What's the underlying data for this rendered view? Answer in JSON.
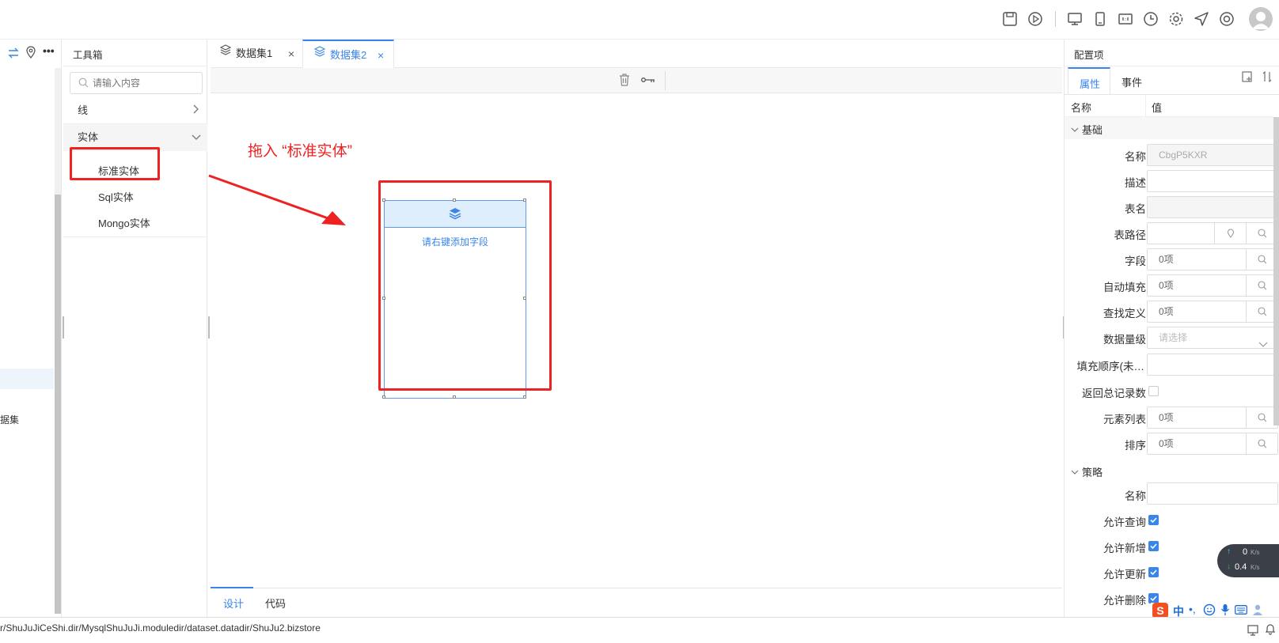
{
  "topbar": {
    "icons": [
      "save-icon",
      "play-icon",
      "desktop-icon",
      "mobile-icon",
      "ratio-icon",
      "history-icon",
      "gear-icon",
      "send-icon",
      "help-icon",
      "avatar"
    ]
  },
  "left_panel": {
    "partial_label": "据集"
  },
  "toolbox": {
    "title": "工具箱",
    "search_placeholder": "请输入内容",
    "groups": [
      {
        "label": "线"
      },
      {
        "label": "实体"
      }
    ],
    "entity_items": [
      "标准实体",
      "Sql实体",
      "Mongo实体"
    ]
  },
  "canvas": {
    "tabs": [
      {
        "label": "数据集1",
        "active": false
      },
      {
        "label": "数据集2",
        "active": true
      }
    ],
    "annotation": "拖入 “标准实体”",
    "entity_hint": "请右键添加字段",
    "bottom_tabs": [
      {
        "label": "设计",
        "active": true
      },
      {
        "label": "代码",
        "active": false
      }
    ]
  },
  "config_panel": {
    "title": "配置项",
    "tabs": [
      {
        "label": "属性",
        "active": true
      },
      {
        "label": "事件",
        "active": false
      }
    ],
    "header_name": "名称",
    "header_value": "值",
    "section_basic": "基础",
    "section_policy": "策略",
    "fields": [
      {
        "label": "名称",
        "value": "CbgP5KXR"
      },
      {
        "label": "描述",
        "value": ""
      },
      {
        "label": "表名",
        "value": ""
      },
      {
        "label": "表路径",
        "value": ""
      },
      {
        "label": "字段",
        "value": "0项"
      },
      {
        "label": "自动填充",
        "value": "0项"
      },
      {
        "label": "查找定义",
        "value": "0项"
      },
      {
        "label": "数据量级",
        "value": "请选择"
      },
      {
        "label": "填充顺序(未…",
        "value": ""
      },
      {
        "label": "返回总记录数",
        "value": ""
      },
      {
        "label": "元素列表",
        "value": "0项"
      },
      {
        "label": "排序",
        "value": "0项"
      }
    ],
    "policy_fields": [
      {
        "label": "名称",
        "value": ""
      },
      {
        "label": "允许查询"
      },
      {
        "label": "允许新增"
      },
      {
        "label": "允许更新"
      },
      {
        "label": "允许删除"
      }
    ]
  },
  "network": {
    "up": "0",
    "down": "0.4",
    "unit": "K/s"
  },
  "ime": {
    "lang": "中"
  },
  "statusbar": {
    "path": "r/ShuJuJiCeShi.dir/MysqlShuJuJi.moduledir/dataset.datadir/ShuJu2.bizstore"
  },
  "colors": {
    "accent": "#3a85e8",
    "annotation_red": "#ee2222",
    "entity_header": "#dfeefd"
  }
}
